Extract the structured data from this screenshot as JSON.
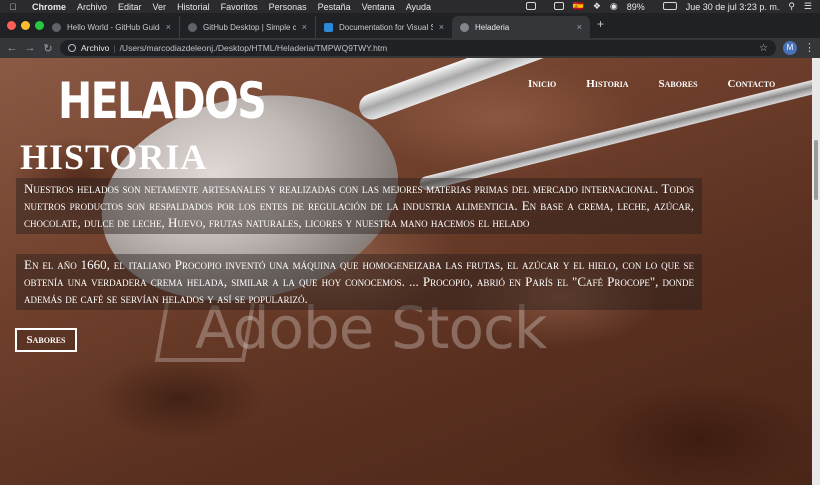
{
  "os_menubar": {
    "app": "Chrome",
    "items": [
      "Archivo",
      "Editar",
      "Ver",
      "Historial",
      "Favoritos",
      "Personas",
      "Pestaña",
      "Ventana",
      "Ayuda"
    ],
    "flag": "🇪🇸",
    "battery": "89%",
    "datetime": "Jue 30 de jul  3:23 p. m."
  },
  "tabs": [
    {
      "title": "Hello World - GitHub Guides",
      "close": "×"
    },
    {
      "title": "GitHub Desktop | Simple collab",
      "close": "×"
    },
    {
      "title": "Documentation for Visual Studio",
      "close": "×"
    },
    {
      "title": "Heladeria",
      "close": "×"
    }
  ],
  "new_tab": "+",
  "address_bar": {
    "scheme_label": "Archivo",
    "separator": "|",
    "url": "/Users/marcodiazdeleonj./Desktop/HTML/Heladeria/TMPWQ9TWY.htm",
    "avatar_letter": "M"
  },
  "site": {
    "logo": "HELADOS",
    "nav": [
      "Inicio",
      "Historia",
      "Sabores",
      "Contacto"
    ],
    "section_title": "HISTORIA",
    "paragraph1": "Nuestros helados son netamente artesanales y realizadas con las mejores materias primas del mercado internacional. Todos nuetros productos son respaldados por los entes de regulación de la industria alimenticia. En base a crema, leche, azúcar, chocolate, dulce de leche, Huevo, frutas naturales, licores y nuestra mano hacemos el helado",
    "paragraph2": "En el año 1660, el italiano Procopio inventó una máquina que homogeneizaba las frutas, el azúcar y el hielo, con lo que se obtenía una verdadera crema helada, similar a la que hoy conocemos. ... Procopio, abrió en París el \"Café Procope\", donde además de café se servían helados y así se popularizó.",
    "button_label": "Sabores",
    "watermark": "Adobe Stock"
  }
}
